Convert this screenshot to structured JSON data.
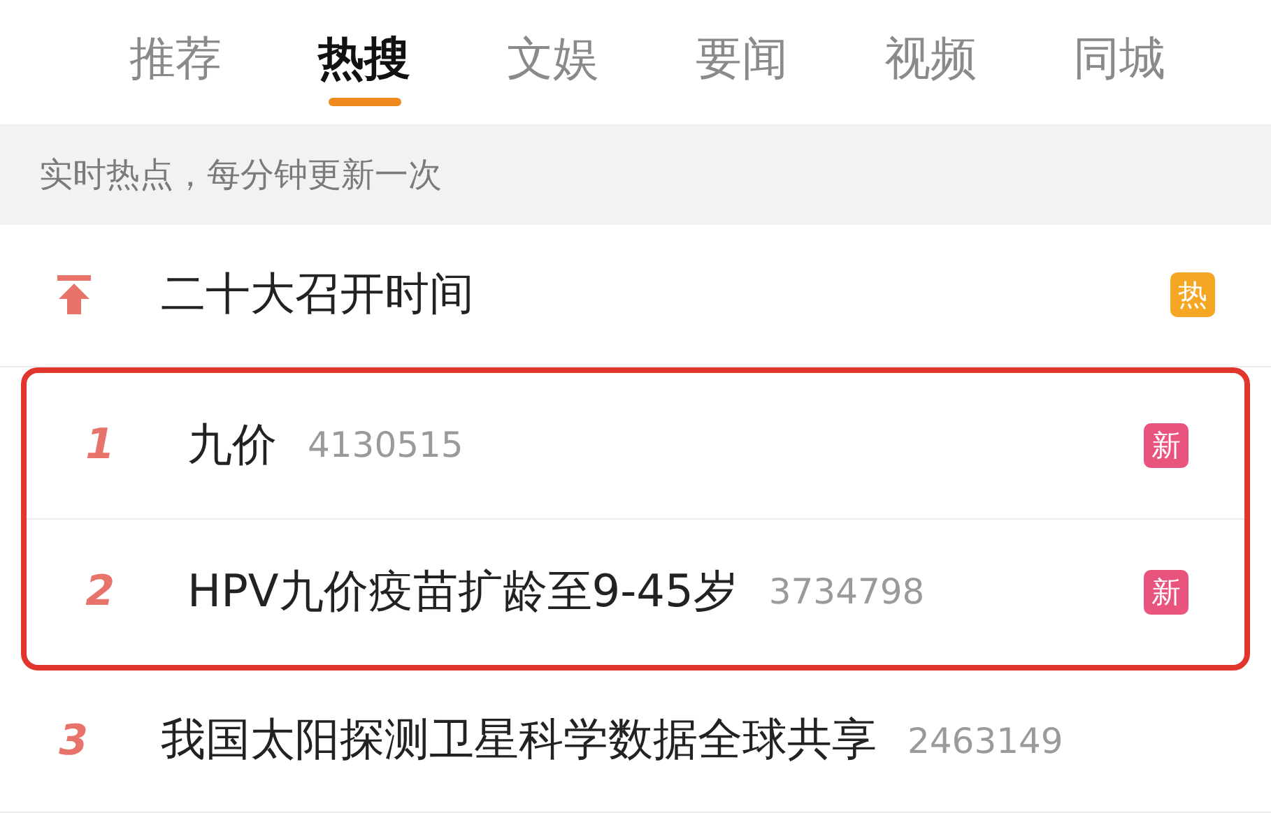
{
  "tabs": [
    {
      "label": "推荐",
      "selected": false
    },
    {
      "label": "热搜",
      "selected": true
    },
    {
      "label": "文娱",
      "selected": false
    },
    {
      "label": "要闻",
      "selected": false
    },
    {
      "label": "视频",
      "selected": false
    },
    {
      "label": "同城",
      "selected": false
    }
  ],
  "notice": "实时热点，每分钟更新一次",
  "rows": [
    {
      "kind": "pinned",
      "title": "二十大召开时间",
      "badge": {
        "text": "热",
        "color": "#f5a623"
      },
      "highlighted": false
    },
    {
      "kind": "ranked",
      "rank": "1",
      "title": "九价",
      "count": "4130515",
      "badge": {
        "text": "新",
        "color": "#e9547f"
      },
      "highlighted": true
    },
    {
      "kind": "ranked",
      "rank": "2",
      "title": "HPV九价疫苗扩龄至9-45岁",
      "count": "3734798",
      "badge": {
        "text": "新",
        "color": "#e9547f"
      },
      "highlighted": true
    },
    {
      "kind": "ranked",
      "rank": "3",
      "title": "我国太阳探测卫星科学数据全球共享",
      "count": "2463149",
      "highlighted": false
    }
  ]
}
